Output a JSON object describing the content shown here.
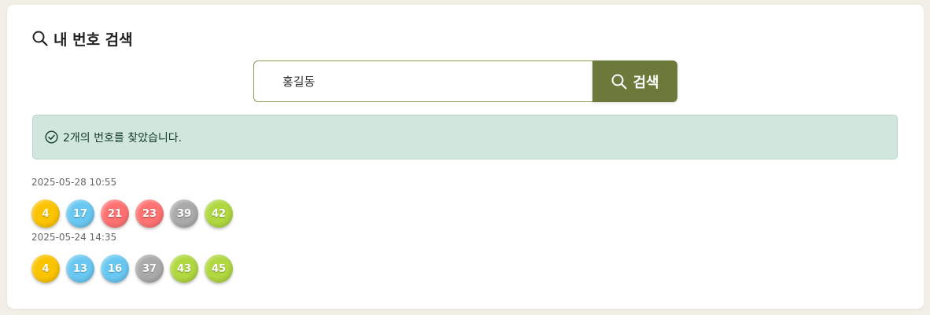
{
  "page": {
    "title": "내 번호 검색"
  },
  "search": {
    "value": "홍길동",
    "button_label": "검색"
  },
  "alert": {
    "message": "2개의 번호를 찾았습니다."
  },
  "results": [
    {
      "date": "2025-05-28 10:55",
      "numbers": [
        {
          "value": "4",
          "color": "#fbc400"
        },
        {
          "value": "17",
          "color": "#69c8f2"
        },
        {
          "value": "21",
          "color": "#ff7272"
        },
        {
          "value": "23",
          "color": "#ff7272"
        },
        {
          "value": "39",
          "color": "#aaaaaa"
        },
        {
          "value": "42",
          "color": "#b0d840"
        }
      ]
    },
    {
      "date": "2025-05-24 14:35",
      "numbers": [
        {
          "value": "4",
          "color": "#fbc400"
        },
        {
          "value": "13",
          "color": "#69c8f2"
        },
        {
          "value": "16",
          "color": "#69c8f2"
        },
        {
          "value": "37",
          "color": "#aaaaaa"
        },
        {
          "value": "43",
          "color": "#b0d840"
        },
        {
          "value": "45",
          "color": "#b0d840"
        }
      ]
    }
  ],
  "colors": {
    "accent": "#6b7a3b",
    "alert_bg": "#d1e7dd",
    "page_bg": "#f2efe6"
  },
  "icons": {
    "title": "search-icon",
    "button": "search-icon",
    "alert": "check-circle-icon"
  }
}
